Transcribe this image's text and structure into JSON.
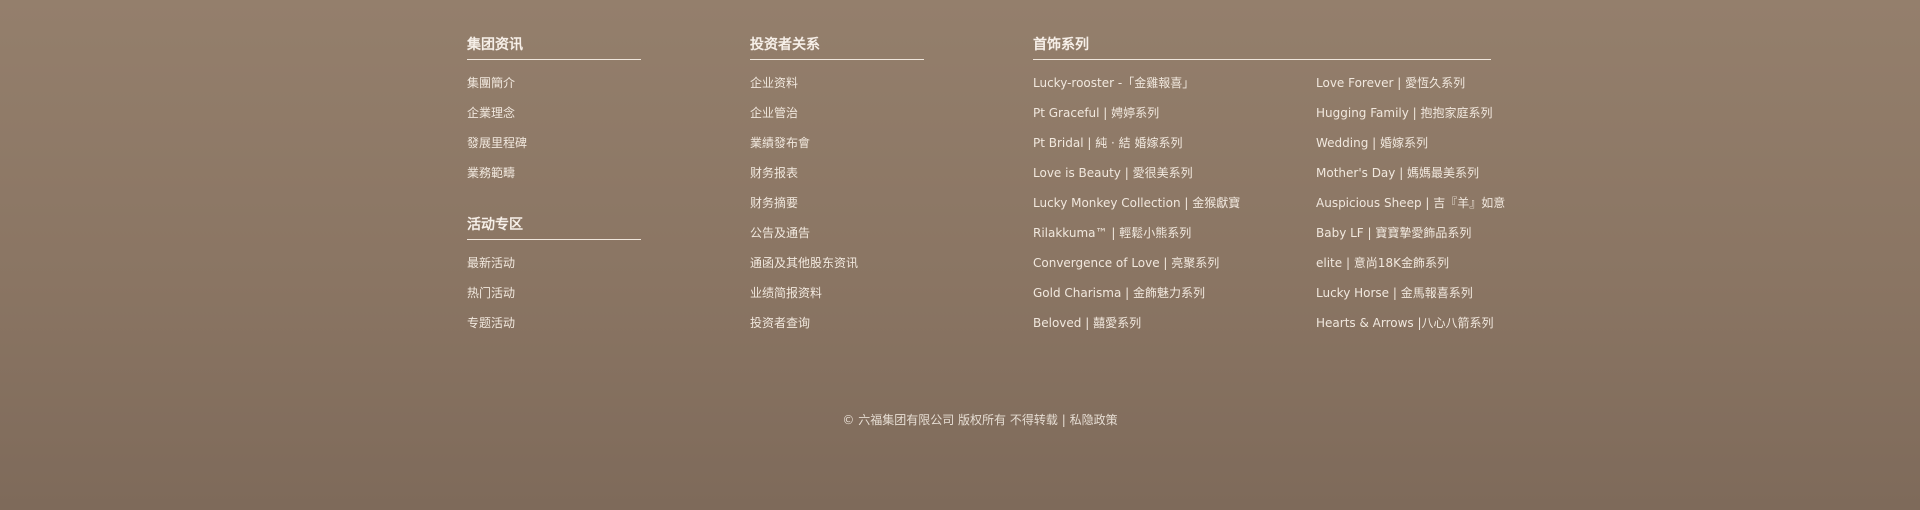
{
  "group": {
    "title": "集团资讯",
    "links": [
      "集團簡介",
      "企業理念",
      "發展里程碑",
      "業務範疇"
    ]
  },
  "activities": {
    "title": "活动专区",
    "links": [
      "最新活动",
      "热门活动",
      "专题活动"
    ]
  },
  "investors": {
    "title": "投资者关系",
    "links": [
      "企业资料",
      "企业管治",
      "業績發布會",
      "财务报表",
      "财务摘要",
      "公告及通告",
      "通函及其他股东资讯",
      "业绩简报资料",
      "投资者查询"
    ]
  },
  "jewelry": {
    "title": "首饰系列",
    "left": [
      "Lucky-rooster -「金雞報喜」",
      "Pt Graceful | 娉婷系列",
      "Pt Bridal | 純 · 結 婚嫁系列",
      "Love is Beauty | 愛很美系列",
      "Lucky Monkey Collection | 金猴獻寶",
      "Rilakkuma™ | 輕鬆小熊系列",
      "Convergence of Love | 亮聚系列",
      "Gold Charisma | 金飾魅力系列",
      "Beloved | 囍愛系列"
    ],
    "right": [
      "Love Forever | 愛恆久系列",
      "Hugging Family | 抱抱家庭系列",
      "Wedding | 婚嫁系列",
      "Mother's Day | 媽媽最美系列",
      "Auspicious Sheep | 吉『羊』如意",
      "Baby LF | 寶寶摯愛飾品系列",
      "elite | 意尚18K金飾系列",
      "Lucky Horse | 金馬報喜系列",
      "Hearts & Arrows |八心八箭系列"
    ]
  },
  "footer": {
    "copyright": "© 六福集团有限公司 版权所有 不得转载",
    "separator": "|",
    "privacy": "私隐政策"
  }
}
